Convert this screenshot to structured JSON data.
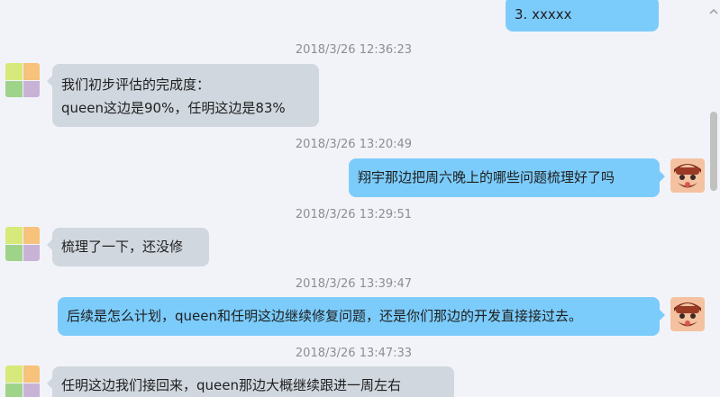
{
  "messages": [
    {
      "kind": "text",
      "side": "right",
      "text": "3. xxxxx"
    },
    {
      "kind": "time",
      "text": "2018/3/26 12:36:23"
    },
    {
      "kind": "text",
      "side": "left",
      "line1": "我们初步评估的完成度：",
      "line2": "queen这边是90%，任明这边是83%"
    },
    {
      "kind": "time",
      "text": "2018/3/26 13:20:49"
    },
    {
      "kind": "text",
      "side": "right",
      "text": "翔宇那边把周六晚上的哪些问题梳理好了吗"
    },
    {
      "kind": "time",
      "text": "2018/3/26 13:29:51"
    },
    {
      "kind": "text",
      "side": "left",
      "text": "梳理了一下，还没修"
    },
    {
      "kind": "time",
      "text": "2018/3/26 13:39:47"
    },
    {
      "kind": "text",
      "side": "right",
      "text": "后续是怎么计划，queen和任明这边继续修复问题，还是你们那边的开发直接接过去。"
    },
    {
      "kind": "time",
      "text": "2018/3/26 13:47:33"
    },
    {
      "kind": "text",
      "side": "left",
      "text": "任明这边我们接回来，queen那边大概继续跟进一周左右"
    }
  ],
  "colors": {
    "background": "#f2f3f8",
    "left_bubble": "#d0d7df",
    "right_bubble": "#7cccfb",
    "timestamp": "#8a8e96"
  },
  "icons": {
    "left_avatar": "multicolor-grid-avatar",
    "right_avatar": "cartoon-face-avatar",
    "scroll_up": "chevron-up-icon"
  }
}
